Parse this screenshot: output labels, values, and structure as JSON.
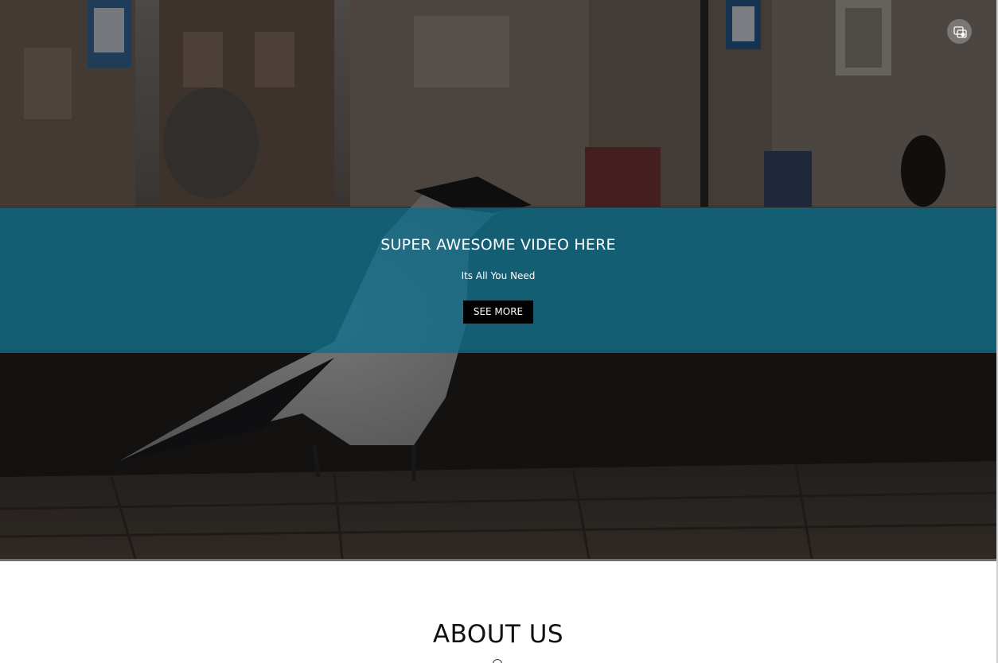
{
  "hero": {
    "background": "photo-crow-on-wall",
    "banner_color": "#106e8c",
    "title": "SUPER AWESOME VIDEO HERE",
    "subtitle": "Its All You Need",
    "cta_label": "SEE MORE",
    "corner_icon": "picture-in-picture-icon"
  },
  "about": {
    "title": "ABOUT US",
    "ornament_icon": "circle-icon"
  }
}
